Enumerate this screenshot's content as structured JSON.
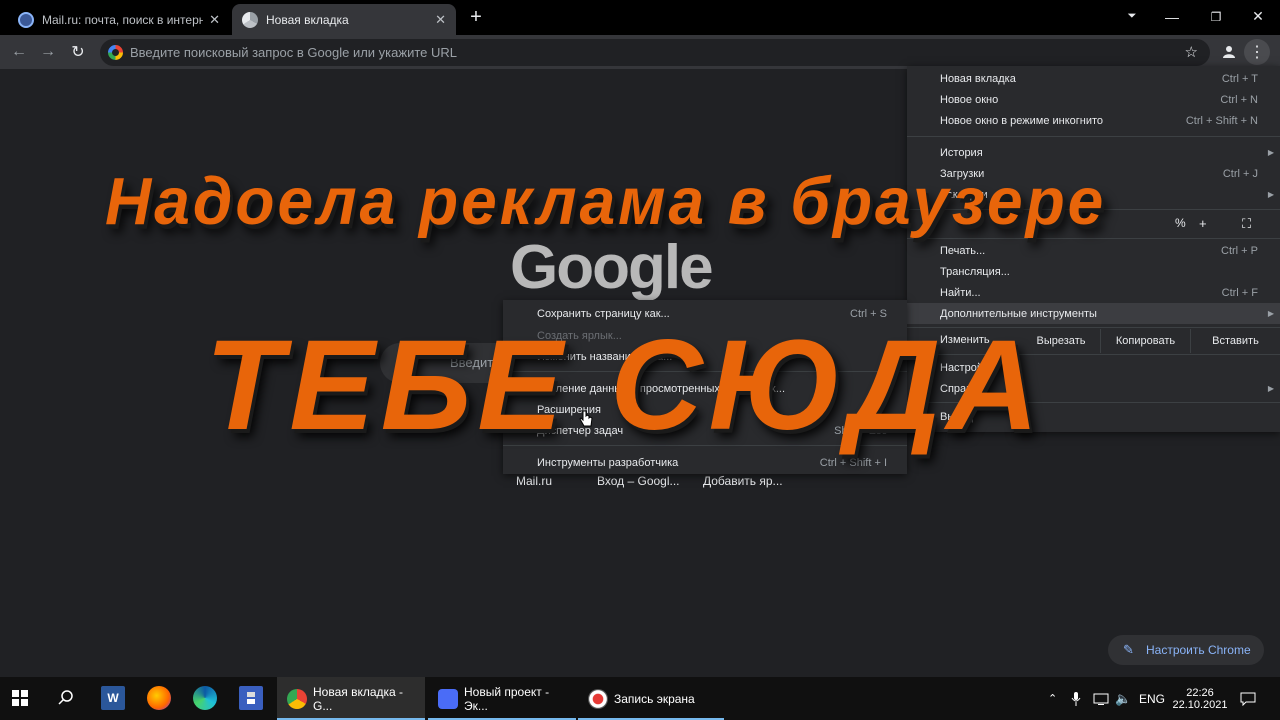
{
  "browser": {
    "tabs": [
      {
        "title": "Mail.ru: почта, поиск в интернет",
        "active": false,
        "icon": "mailru-icon"
      },
      {
        "title": "Новая вкладка",
        "active": true,
        "icon": "chrome-icon"
      }
    ],
    "new_tab_symbol": "+",
    "address_placeholder": "Введите поисковый запрос в Google или укажите URL"
  },
  "page": {
    "logo_text": "Google",
    "search_placeholder": "Введите по",
    "shortcuts": [
      "Mail.ru",
      "Вход – Googl...",
      "Добавить яр..."
    ],
    "customize_label": "Настроить Chrome"
  },
  "main_menu": {
    "items_top": [
      {
        "label": "Новая вкладка",
        "shortcut": "Ctrl + T"
      },
      {
        "label": "Новое окно",
        "shortcut": "Ctrl + N"
      },
      {
        "label": "Новое окно в режиме инкогнито",
        "shortcut": "Ctrl + Shift + N"
      }
    ],
    "items_mid": [
      {
        "label": "История",
        "shortcut": ""
      },
      {
        "label": "Загрузки",
        "shortcut": "Ctrl + J"
      },
      {
        "label": "Закладки",
        "shortcut": ""
      }
    ],
    "zoom": {
      "value": "%",
      "plus": "+"
    },
    "items_low": [
      {
        "label": "Печать...",
        "shortcut": "Ctrl + P"
      },
      {
        "label": "Трансляция...",
        "shortcut": ""
      },
      {
        "label": "Найти...",
        "shortcut": "Ctrl + F"
      },
      {
        "label": "Дополнительные инструменты",
        "shortcut": ""
      }
    ],
    "edit": {
      "cut": "Вырезать",
      "copy": "Копировать",
      "paste": "Вставить"
    },
    "items_bottom": [
      {
        "label": "Настройки"
      },
      {
        "label": "Справка"
      },
      {
        "label": "Выход"
      }
    ]
  },
  "sub_menu": {
    "items": [
      {
        "label": "Сохранить страницу как...",
        "shortcut": "Ctrl + S",
        "dim": false
      },
      {
        "label": "Создать ярлык...",
        "shortcut": "",
        "dim": true
      },
      {
        "label": "Изменить название окна...",
        "shortcut": "",
        "dim": false
      },
      {
        "label": "Удаление данных о просмотренных страницах...",
        "shortcut": "",
        "dim": false
      },
      {
        "label": "Расширения",
        "shortcut": "",
        "dim": false
      },
      {
        "label": "Диспетчер задач",
        "shortcut": "Shift + Esc",
        "dim": false
      },
      {
        "label": "Инструменты разработчика",
        "shortcut": "Ctrl + Shift + I",
        "dim": false
      }
    ]
  },
  "overlay": {
    "headline_1": "Надоела реклама в браузере",
    "headline_2": "ТЕБЕ СЮДА",
    "color": "#e8650a"
  },
  "taskbar": {
    "apps": [
      {
        "label": "Новая вкладка - G...",
        "icon": "chrome-icon"
      },
      {
        "label": "Новый проект - Эк...",
        "icon": "camera-icon"
      },
      {
        "label": "Запись экрана",
        "icon": "record-icon"
      }
    ],
    "lang": "ENG",
    "time": "22:26",
    "date": "22.10.2021"
  }
}
